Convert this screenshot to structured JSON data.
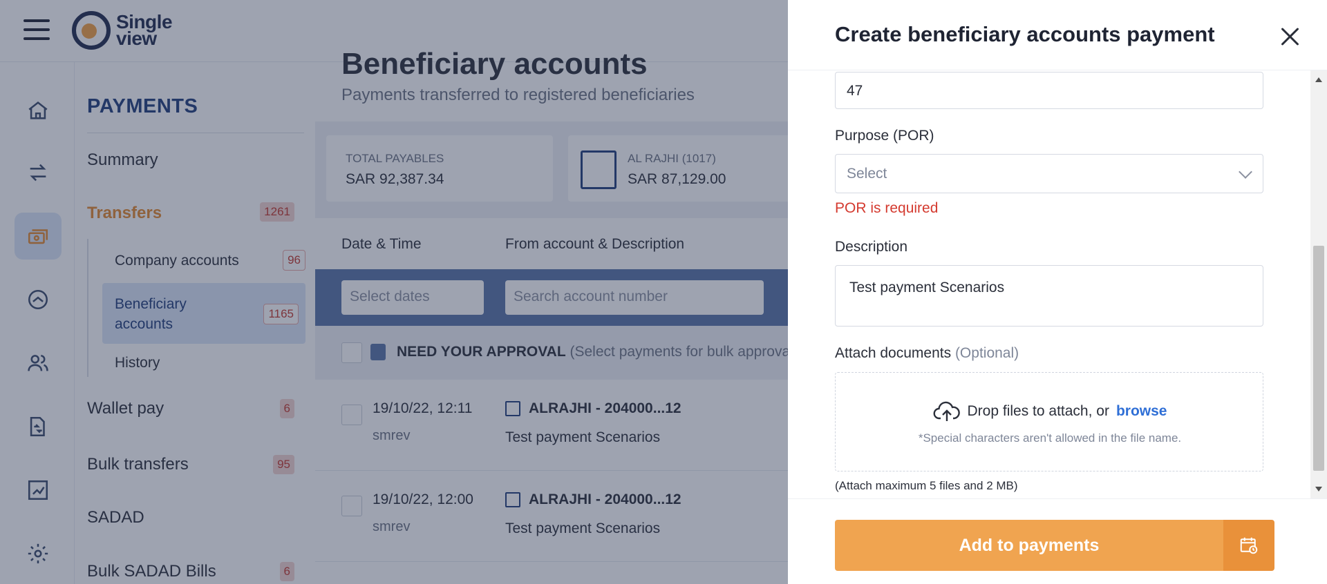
{
  "brand": {
    "logo_line1": "Single",
    "logo_line2": "view"
  },
  "subnav": {
    "title": "PAYMENTS",
    "summary": "Summary",
    "transfers": {
      "label": "Transfers",
      "count": "1261"
    },
    "company_accounts": {
      "label": "Company accounts",
      "count": "96"
    },
    "beneficiary_accounts": {
      "label": "Beneficiary accounts",
      "count": "1165"
    },
    "history": "History",
    "wallet_pay": {
      "label": "Wallet pay",
      "count": "6"
    },
    "bulk_transfers": {
      "label": "Bulk transfers",
      "count": "95"
    },
    "sadad": "SADAD",
    "bulk_sadad": {
      "label": "Bulk SADAD Bills",
      "count": "6"
    }
  },
  "main": {
    "title": "Beneficiary accounts",
    "subtitle": "Payments transferred to registered beneficiaries",
    "cards": [
      {
        "label": "TOTAL PAYABLES",
        "value": "SAR 92,387.34"
      },
      {
        "label": "AL RAJHI  (1017)",
        "value": "SAR 87,129.00"
      }
    ],
    "columns": {
      "date": "Date & Time",
      "from": "From account & Description"
    },
    "filters": {
      "dates_placeholder": "Select dates",
      "search_placeholder": "Search account number"
    },
    "approval": {
      "title": "NEED YOUR APPROVAL",
      "hint": "(Select payments for bulk approva"
    },
    "rows": [
      {
        "date": "19/10/22, 12:11",
        "user": "smrev",
        "account": "ALRAJHI - 204000...12",
        "description": "Test payment Scenarios"
      },
      {
        "date": "19/10/22, 12:00",
        "user": "smrev",
        "account": "ALRAJHI - 204000...12",
        "description": "Test payment Scenarios"
      }
    ]
  },
  "drawer": {
    "title": "Create beneficiary accounts payment",
    "amount_value": "47",
    "purpose_label": "Purpose (POR)",
    "purpose_placeholder": "Select",
    "purpose_error": "POR is required",
    "description_label": "Description",
    "description_value": "Test payment Scenarios",
    "attach_label": "Attach documents",
    "attach_optional": "(Optional)",
    "drop_text": "Drop files to attach, or",
    "browse": "browse",
    "special_note": "*Special characters aren't allowed in the file name.",
    "limit_note": "(Attach maximum 5 files and 2 MB)",
    "submit_label": "Add to payments"
  },
  "colors": {
    "accent": "#f0a450",
    "error": "#d43a2f",
    "link": "#2f6fd6",
    "brand_navy": "#1f3c7a"
  },
  "icons": [
    "menu-icon",
    "home-icon",
    "transfer-icon",
    "payments-icon",
    "savings-icon",
    "users-icon",
    "documents-icon",
    "reports-icon",
    "settings-icon",
    "close-icon",
    "chevron-down-icon",
    "upload-cloud-icon",
    "calendar-icon"
  ]
}
